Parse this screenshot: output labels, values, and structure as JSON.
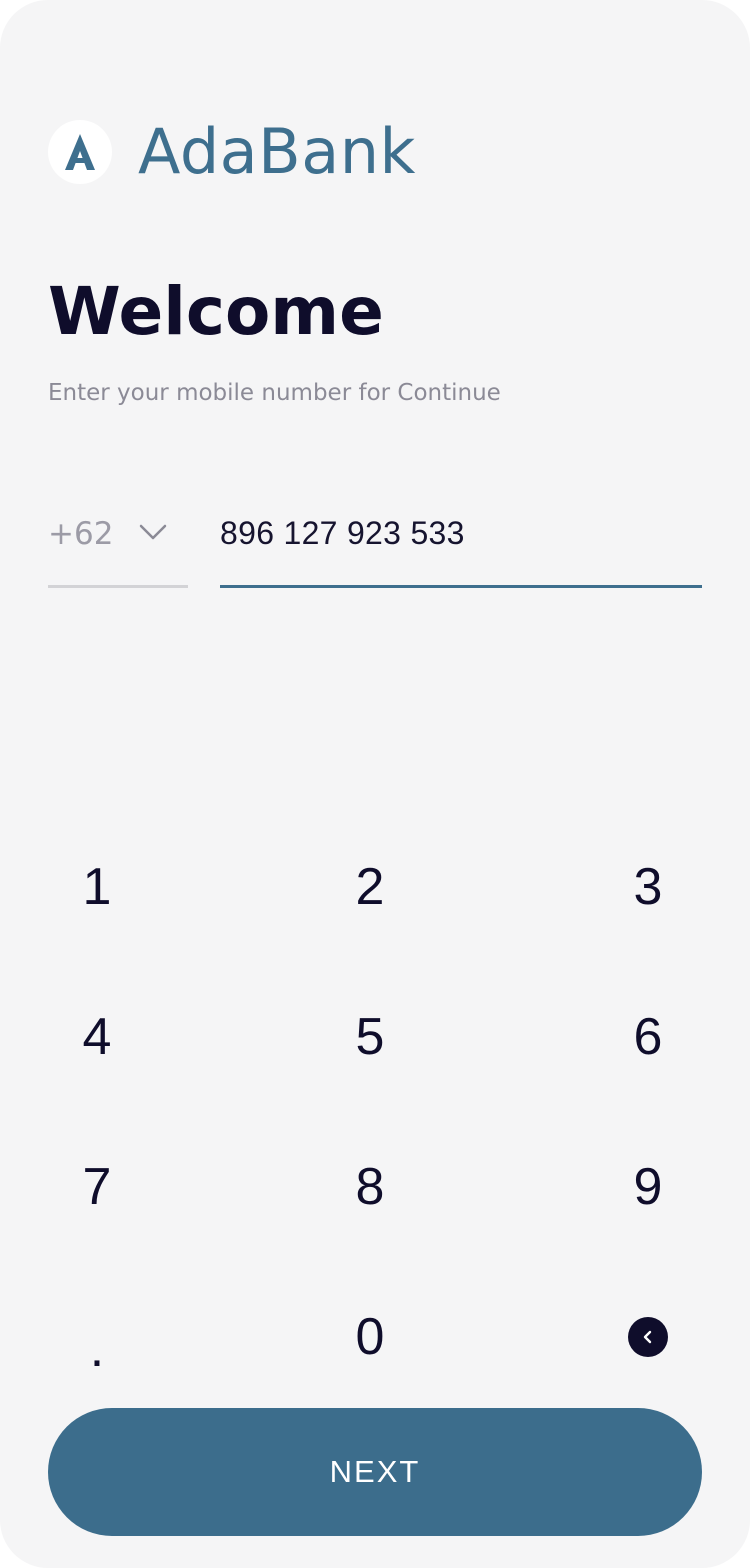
{
  "brand": {
    "logo_letter": "A",
    "name": "AdaBank",
    "color": "#3e6f8e"
  },
  "title": "Welcome",
  "subtitle": "Enter your mobile number  for Continue",
  "phone": {
    "country_code": "+62",
    "country_dropdown_icon": "chevron-down-icon",
    "number": "896 127 923 533"
  },
  "keypad": {
    "keys": [
      "1",
      "2",
      "3",
      "4",
      "5",
      "6",
      "7",
      "8",
      "9",
      ".",
      "0"
    ],
    "backspace_icon": "backspace-icon"
  },
  "next_button": {
    "label": "NEXT",
    "color": "#3c6d8c"
  },
  "colors": {
    "background": "#f5f5f6",
    "text_dark": "#0f0d2b",
    "text_muted": "#8b8a96",
    "accent": "#3e6f8e"
  }
}
